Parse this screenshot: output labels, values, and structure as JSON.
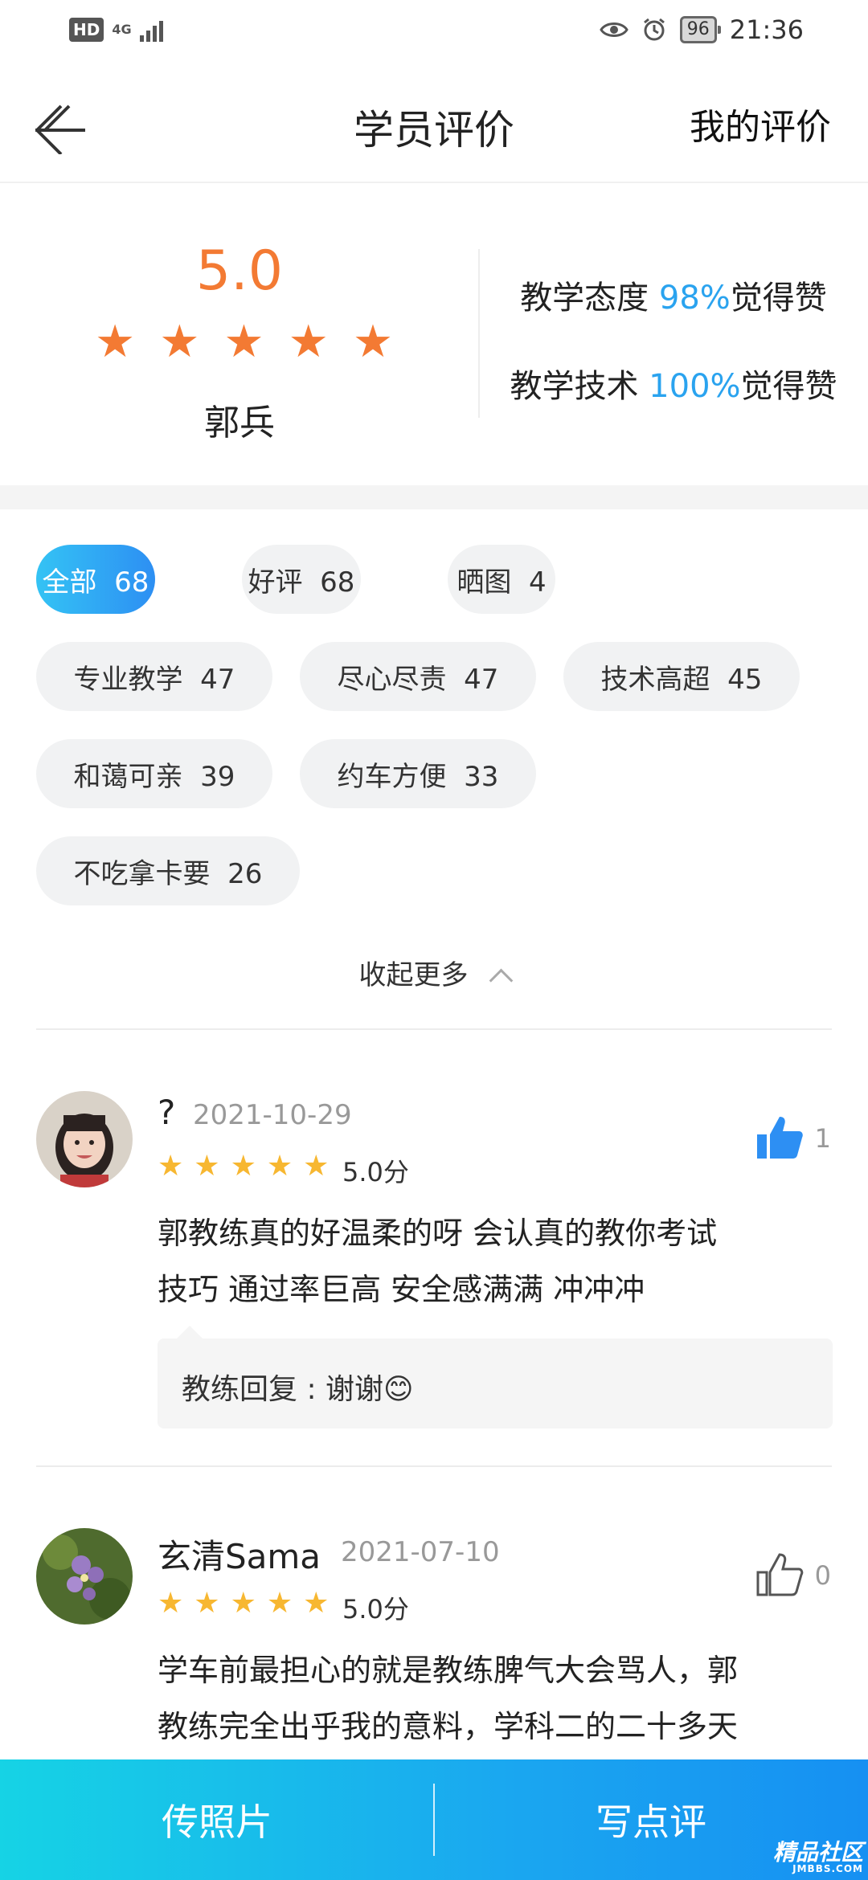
{
  "status_bar": {
    "hd": "HD",
    "network": "4G",
    "battery": "96",
    "time": "21:36"
  },
  "header": {
    "title": "学员评价",
    "my_reviews": "我的评价"
  },
  "summary": {
    "score": "5.0",
    "rating_stars": 5,
    "coach_name": "郭兵",
    "stats": [
      {
        "label": "教学态度 ",
        "percent": "98%",
        "suffix": "觉得赞"
      },
      {
        "label": "教学技术 ",
        "percent": "100%",
        "suffix": "觉得赞"
      }
    ]
  },
  "tags": [
    {
      "label": "全部  68",
      "active": true
    },
    {
      "label": "好评  68"
    },
    {
      "label": "晒图  4"
    },
    {
      "label": "专业教学  47"
    },
    {
      "label": "尽心尽责  47"
    },
    {
      "label": "技术高超  45"
    },
    {
      "label": "和蔼可亲  39"
    },
    {
      "label": "约车方便  33"
    },
    {
      "label": "不吃拿卡要  26"
    }
  ],
  "collapse_label": "收起更多",
  "reviews": [
    {
      "name": "?",
      "date": "2021-10-29",
      "stars": 5,
      "score": "5.0分",
      "likes": "1",
      "liked": true,
      "text_lines": [
        "郭教练真的好温柔的呀  会认真的教你考试",
        "技巧  通过率巨高  安全感满满 冲冲冲"
      ],
      "reply_label": "教练回复 : ",
      "reply_text": "谢谢😊"
    },
    {
      "name": "玄清Sama",
      "date": "2021-07-10",
      "stars": 5,
      "score": "5.0分",
      "likes": "0",
      "liked": false,
      "text_lines": [
        "学车前最担心的就是教练脾气大会骂人，郭",
        "教练完全出乎我的意料，学科二的二十多天"
      ]
    }
  ],
  "bottom_bar": {
    "upload_photo": "传照片",
    "write_review": "写点评"
  },
  "watermark": {
    "main": "精品社区",
    "sub": "JMBBS.COM"
  },
  "colors": {
    "accent_orange": "#f37a33",
    "accent_blue": "#2aa3ef",
    "star_yellow": "#f7b731",
    "like_blue": "#2d8ff3"
  }
}
